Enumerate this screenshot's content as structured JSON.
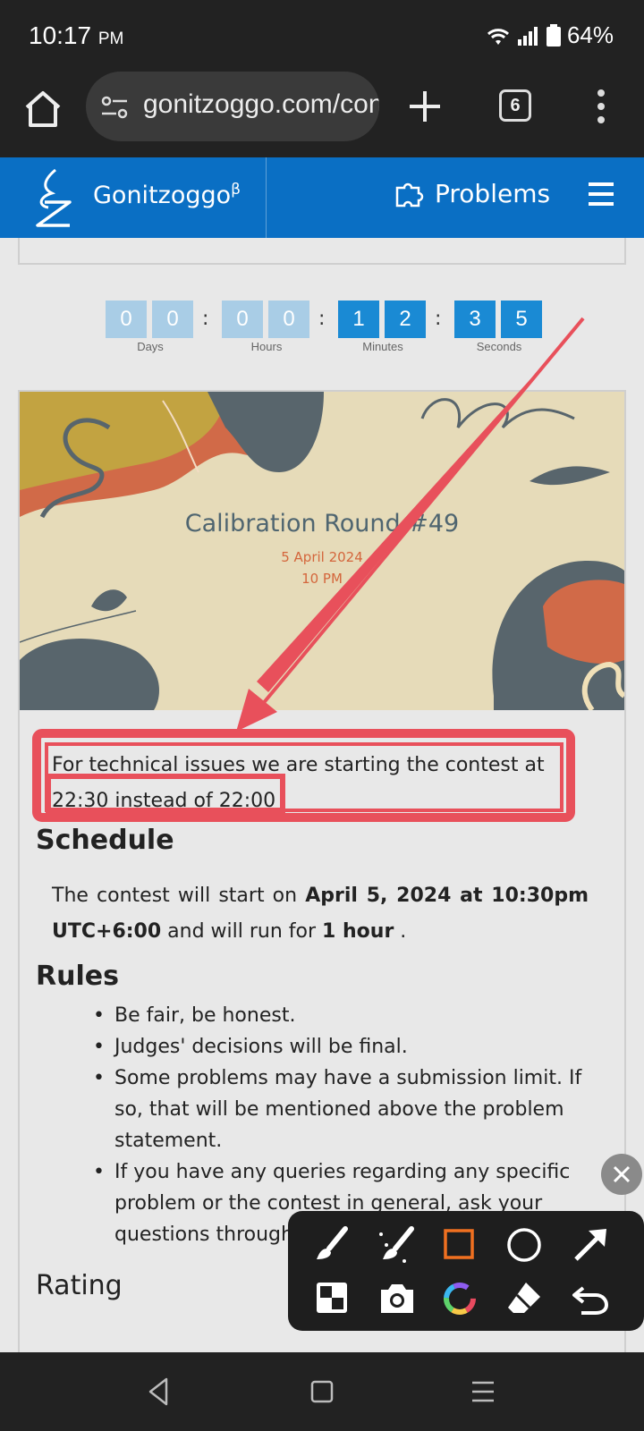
{
  "status_bar": {
    "time": "10:17",
    "ampm": "PM",
    "battery": "64%"
  },
  "browser": {
    "url": "gonitzoggo.com/contest",
    "tab_count": "6"
  },
  "site_header": {
    "name": "Gonitzoggo",
    "beta_mark": "β",
    "problems_label": "Problems"
  },
  "countdown": {
    "days": [
      "0",
      "0"
    ],
    "hours": [
      "0",
      "0"
    ],
    "minutes": [
      "1",
      "2"
    ],
    "seconds": [
      "3",
      "5"
    ],
    "days_label": "Days",
    "hours_label": "Hours",
    "minutes_label": "Minutes",
    "seconds_label": "Seconds",
    "separator": ":"
  },
  "banner": {
    "title": "Calibration Round #49",
    "date": "5 April 2024",
    "time": "10 PM"
  },
  "notice": {
    "line1": "For technical issues we are starting the contest at",
    "line2": "22:30 instead of 22:00"
  },
  "schedule": {
    "heading": "Schedule",
    "text_a": "The contest will start on ",
    "start_bold": "April 5, 2024 at 10:30pm UTC+6:00",
    "text_b": " and will run for ",
    "duration_bold": "1 hour",
    "text_c": " ."
  },
  "rules": {
    "heading": "Rules",
    "items": [
      "Be fair, be honest.",
      "Judges' decisions will be final.",
      "Some problems may have a submission limit. If so, that will be mentioned above the problem statement.",
      "If you have any queries regarding any specific problem or the contest in general, ask your questions through the clarification page."
    ]
  },
  "rating": {
    "heading": "Rating"
  },
  "colors": {
    "header_blue": "#0a6fc4",
    "annotation_red": "#e8505b",
    "countdown_lit": "#1a8ad4",
    "countdown_dim": "#a9cde6"
  },
  "draw_tools": [
    "brush-icon",
    "eraser-sparkle-icon",
    "rectangle-icon",
    "circle-icon",
    "arrow-icon",
    "mosaic-icon",
    "camera-icon",
    "color-wheel-icon",
    "eraser-icon",
    "undo-icon"
  ]
}
